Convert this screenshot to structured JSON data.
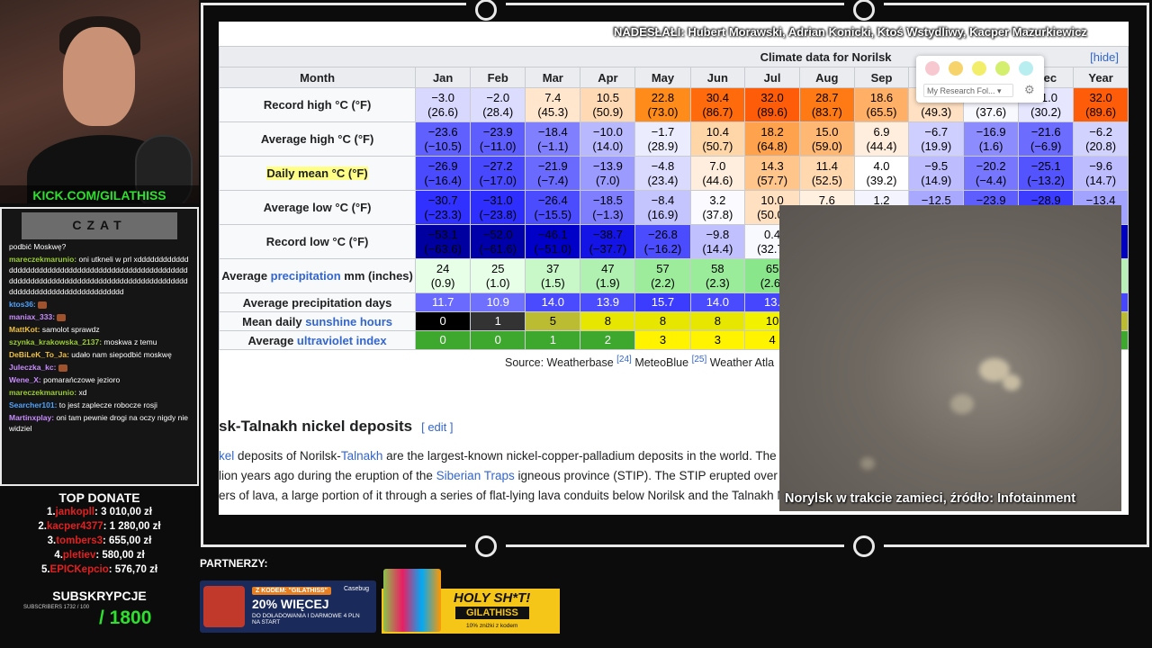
{
  "stream": {
    "kick_url": "KICK.COM/GILATHISS",
    "credit": "NADESŁAŁI: Hubert Morawski, Adrian Konicki, Ktoś Wstydliwy, Kacper Mazurkiewicz",
    "video_caption": "Norylsk w trakcie zamieci, źródło: Infotainment",
    "partners_label": "PARTNERZY:"
  },
  "chat": {
    "title": "CZAT",
    "messages": [
      {
        "user": "",
        "text": "podbić Moskwę?",
        "color": "#ffffff"
      },
      {
        "user": "mareczekmarunio:",
        "text": "oni utkneli w prl xddddddddddddddddddddddddddddddddddddddddddddddddddddddddddddddddddddddddddddddddddddddddddddddddddddddddddddddddddddddddddd",
        "color": "#9acd32"
      },
      {
        "user": "ktos36:",
        "text": "",
        "color": "#4fa3ff",
        "emote": true
      },
      {
        "user": "maniax_333:",
        "text": "",
        "color": "#c98cff",
        "emote": true
      },
      {
        "user": "MattKot:",
        "text": "samolot sprawdz",
        "color": "#f0c040"
      },
      {
        "user": "szynka_krakowska_2137:",
        "text": "moskwa z temu",
        "color": "#9acd32"
      },
      {
        "user": "DeBiLeK_To_Ja:",
        "text": "udało nam siepodbić moskwę",
        "color": "#f0c040"
      },
      {
        "user": "Juleczka_kc:",
        "text": "",
        "color": "#c98cff",
        "emote": true
      },
      {
        "user": "Wene_X:",
        "text": "pomarańczowe jezioro",
        "color": "#c98cff"
      },
      {
        "user": "mareczekmarunio:",
        "text": "xd",
        "color": "#9acd32"
      },
      {
        "user": "Searcher101:",
        "text": "to jest zaplecze robocze rosji",
        "color": "#4fa3ff"
      },
      {
        "user": "Martinxplay:",
        "text": "oni tam pewnie drogi na oczy nigdy nie widziel",
        "color": "#c98cff"
      }
    ]
  },
  "donate": {
    "title": "TOP DONATE",
    "rows": [
      {
        "rank": "1.",
        "name": "jankopll",
        "amount": ": 3 010,00 zł"
      },
      {
        "rank": "2.",
        "name": "kacper4377",
        "amount": ": 1 280,00 zł"
      },
      {
        "rank": "3.",
        "name": "tombers3",
        "amount": ": 655,00 zł"
      },
      {
        "rank": "4.",
        "name": "pletiev",
        "amount": ": 580,00 zł"
      },
      {
        "rank": "5.",
        "name": "EPICKepcio",
        "amount": ": 576,70 zł"
      }
    ]
  },
  "subs": {
    "title": "SUBSKRYPCJE",
    "small": "SUBSCRIBERS 1732 / 100",
    "goal": "/ 1800"
  },
  "ads": {
    "ad1": {
      "code": "Z KODEM: \"GILATHISS\"",
      "big": "20% WIĘCEJ",
      "small": "DO DOŁADOWANIA I DARMOWE 4 PLN NA START",
      "brand": "Casebug"
    },
    "ad2": {
      "t1": "HOLY SH*T!",
      "t2": "GILATHISS",
      "t3": "10% zniżki z kodem"
    }
  },
  "wiki": {
    "caption": "Climate data for Norilsk",
    "hide": "hide",
    "months": [
      "Month",
      "Jan",
      "Feb",
      "Mar",
      "Apr",
      "May",
      "Jun",
      "Jul",
      "Aug",
      "Sep",
      "Oct",
      "Nov",
      "Dec",
      "Year"
    ],
    "rows": [
      {
        "label": "Record high °C (°F)",
        "cells": [
          [
            "−3.0",
            "(26.6)"
          ],
          [
            "−2.0",
            "(28.4)"
          ],
          [
            "7.4",
            "(45.3)"
          ],
          [
            "10.5",
            "(50.9)"
          ],
          [
            "22.8",
            "(73.0)"
          ],
          [
            "30.4",
            "(86.7)"
          ],
          [
            "32.0",
            "(89.6)"
          ],
          [
            "28.7",
            "(83.7)"
          ],
          [
            "18.6",
            "(65.5)"
          ],
          [
            "9.6",
            "(49.3)"
          ],
          [
            "3.1",
            "(37.6)"
          ],
          [
            "−1.0",
            "(30.2)"
          ],
          [
            "32.0",
            "(89.6)"
          ]
        ],
        "colors": [
          "#d8d8ff",
          "#dcdcff",
          "#ffe6cc",
          "#ffd9b3",
          "#ff8c1a",
          "#ff6a0d",
          "#ff5c0a",
          "#ff7a14",
          "#ffb066",
          "#ffe0c2",
          "#f8f8ff",
          "#e6e6ff",
          "#ff5c0a"
        ]
      },
      {
        "label": "Average high °C (°F)",
        "cells": [
          [
            "−23.6",
            "(−10.5)"
          ],
          [
            "−23.9",
            "(−11.0)"
          ],
          [
            "−18.4",
            "(−1.1)"
          ],
          [
            "−10.0",
            "(14.0)"
          ],
          [
            "−1.7",
            "(28.9)"
          ],
          [
            "10.4",
            "(50.7)"
          ],
          [
            "18.2",
            "(64.8)"
          ],
          [
            "15.0",
            "(59.0)"
          ],
          [
            "6.9",
            "(44.4)"
          ],
          [
            "−6.7",
            "(19.9)"
          ],
          [
            "−16.9",
            "(1.6)"
          ],
          [
            "−21.6",
            "(−6.9)"
          ],
          [
            "−6.2",
            "(20.8)"
          ]
        ],
        "colors": [
          "#6060ff",
          "#5e5eff",
          "#8080ff",
          "#b8b8ff",
          "#ececff",
          "#ffd6a8",
          "#ffa24d",
          "#ffb873",
          "#ffeedd",
          "#cfcfff",
          "#8c8cff",
          "#6c6cff",
          "#d2d2ff"
        ]
      },
      {
        "label": "Daily mean °C (°F)",
        "cells": [
          [
            "−26.9",
            "(−16.4)"
          ],
          [
            "−27.2",
            "(−17.0)"
          ],
          [
            "−21.9",
            "(−7.4)"
          ],
          [
            "−13.9",
            "(7.0)"
          ],
          [
            "−4.8",
            "(23.4)"
          ],
          [
            "7.0",
            "(44.6)"
          ],
          [
            "14.3",
            "(57.7)"
          ],
          [
            "11.4",
            "(52.5)"
          ],
          [
            "4.0",
            "(39.2)"
          ],
          [
            "−9.5",
            "(14.9)"
          ],
          [
            "−20.2",
            "(−4.4)"
          ],
          [
            "−25.1",
            "(−13.2)"
          ],
          [
            "−9.6",
            "(14.7)"
          ]
        ],
        "colors": [
          "#4a4aff",
          "#4848ff",
          "#6a6aff",
          "#9a9aff",
          "#dadaff",
          "#ffeedd",
          "#ffc58a",
          "#ffd8b0",
          "#ffffff",
          "#bcbcff",
          "#7676ff",
          "#5454ff",
          "#bcbcff"
        ]
      },
      {
        "label": "Average low °C (°F)",
        "cells": [
          [
            "−30.7",
            "(−23.3)"
          ],
          [
            "−31.0",
            "(−23.8)"
          ],
          [
            "−26.4",
            "(−15.5)"
          ],
          [
            "−18.5",
            "(−1.3)"
          ],
          [
            "−8.4",
            "(16.9)"
          ],
          [
            "3.2",
            "(37.8)"
          ],
          [
            "10.0",
            "(50.0)"
          ],
          [
            "7.6",
            "(45.7)"
          ],
          [
            "1.2",
            "(34.2)"
          ],
          [
            "−12.5",
            "(9.5)"
          ],
          [
            "−23.9",
            "(−11.0)"
          ],
          [
            "−28.9",
            "(−20.0)"
          ],
          [
            "−13.4",
            "(7.9)"
          ]
        ],
        "colors": [
          "#3030ff",
          "#2e2eff",
          "#4c4cff",
          "#7e7eff",
          "#c4c4ff",
          "#fbfbff",
          "#ffe0c0",
          "#fff0e0",
          "#f4f4ff",
          "#a8a8ff",
          "#5e5eff",
          "#3c3cff",
          "#a2a2ff"
        ]
      },
      {
        "label": "Record low °C (°F)",
        "cells": [
          [
            "−53.1",
            "(−63.6)"
          ],
          [
            "−52.0",
            "(−61.6)"
          ],
          [
            "−46.1",
            "(−51.0)"
          ],
          [
            "−38.7",
            "(−37.7)"
          ],
          [
            "−26.8",
            "(−16.2)"
          ],
          [
            "−9.8",
            "(14.4)"
          ],
          [
            "0.4",
            "(32.7)"
          ],
          [
            "",
            "",
            ""
          ],
          [
            "",
            ""
          ],
          [
            "",
            ""
          ],
          [
            "",
            ""
          ],
          [
            "",
            ""
          ],
          [
            "",
            ""
          ]
        ],
        "colors": [
          "#0000a0",
          "#0000aa",
          "#0000c8",
          "#1414e6",
          "#4c4cff",
          "#c0c0ff",
          "#f8f8ff",
          "#fff",
          "#fff",
          "#fff",
          "#fff",
          "#fff",
          "#0000c0"
        ]
      }
    ],
    "precip": {
      "label_prefix": "Average ",
      "label_link": "precipitation",
      "label_suffix": " mm (inches)",
      "cells": [
        [
          "24",
          "(0.9)"
        ],
        [
          "25",
          "(1.0)"
        ],
        [
          "37",
          "(1.5)"
        ],
        [
          "47",
          "(1.9)"
        ],
        [
          "57",
          "(2.2)"
        ],
        [
          "58",
          "(2.3)"
        ],
        [
          "65",
          "(2.6)"
        ]
      ],
      "colors": [
        "#e6ffe6",
        "#e6ffe6",
        "#c8f7c8",
        "#b0f0b0",
        "#9cec9c",
        "#9aeb9a",
        "#8ae68a"
      ]
    },
    "precip_days": {
      "label": "Average precipitation days",
      "cells": [
        "11.7",
        "10.9",
        "14.0",
        "13.9",
        "15.7",
        "14.0",
        "13."
      ],
      "colors": [
        "#6a6aff",
        "#7070ff",
        "#4a4aff",
        "#4c4cff",
        "#3c3cff",
        "#4a4aff",
        "#4646ff"
      ]
    },
    "sunshine": {
      "label_prefix": "Mean daily ",
      "label_link": "sunshine hours",
      "cells": [
        "0",
        "1",
        "5",
        "8",
        "8",
        "8",
        "10"
      ],
      "colors": [
        "#000000",
        "#333333",
        "#bcbc33",
        "#e6e600",
        "#e6e600",
        "#e6e600",
        "#f2f200"
      ],
      "text_colors": [
        "#ffffff",
        "#ffffff",
        "#000000",
        "#000000",
        "#000000",
        "#000000",
        "#000000"
      ]
    },
    "uv": {
      "label_prefix": "Average ",
      "label_link": "ultraviolet index",
      "cells": [
        "0",
        "0",
        "1",
        "2",
        "3",
        "3",
        "4"
      ],
      "colors": [
        "#3ea72d",
        "#3ea72d",
        "#3ea72d",
        "#3ea72d",
        "#fff300",
        "#fff300",
        "#fff300"
      ],
      "text_colors": [
        "#ffffff",
        "#ffffff",
        "#ffffff",
        "#ffffff",
        "#000000",
        "#000000",
        "#000000"
      ]
    },
    "source": {
      "prefix": "Source: Weatherbase ",
      "ref1": "[24]",
      "mid": " MeteoBlue ",
      "ref2": "[25]",
      "suffix": " Weather Atla"
    },
    "section_title": "sk-Talnakh nickel deposits",
    "section_edit": "[ edit ]",
    "para": [
      {
        "a": "kel",
        "b": " deposits of Norilsk-",
        "c": "Talnakh",
        "d": " are the largest-known nickel-copper-palladium deposits in the world. The c"
      },
      {
        "a": "",
        "b": "lion years ago during the eruption of the ",
        "c": "Siberian Traps",
        "d": " igneous province (STIP). The STIP erupted over c"
      },
      {
        "a": "",
        "b": "ers of lava, a large portion of it through a series of flat-lying lava conduits below Norilsk and the Talnakh M",
        "c": "",
        "d": ""
      }
    ],
    "popup": {
      "select_label": "My Research Fol...",
      "dot_colors": [
        "#f8c8d0",
        "#f6d36b",
        "#f3ee6a",
        "#d4ef6d",
        "#b9eef0"
      ]
    }
  }
}
